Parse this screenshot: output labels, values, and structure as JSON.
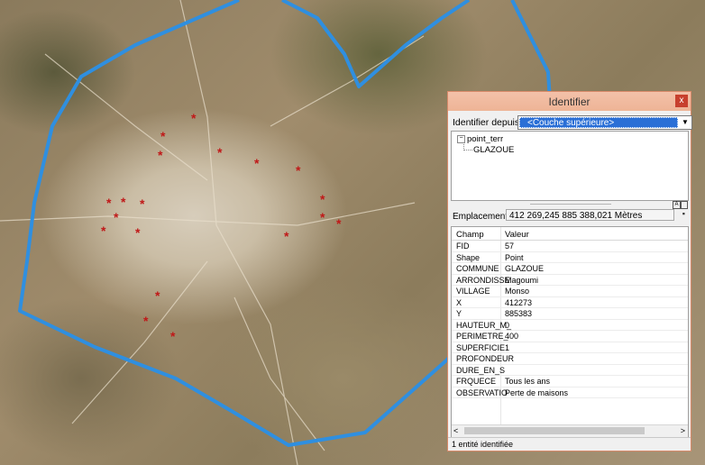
{
  "identify_window": {
    "title": "Identifier",
    "close_glyph": "x",
    "identify_from_label": "Identifier depuis :",
    "identify_from_value": "<Couche supérieure>",
    "tree": {
      "layer": "point_terr",
      "feature": "GLAZOUE"
    },
    "location_label": "Emplacement :",
    "location_value": "412 269,245  885 388,021 Mètres",
    "table": {
      "headers": [
        "Champ",
        "Valeur"
      ],
      "rows": [
        [
          "FID",
          "57"
        ],
        [
          "Shape",
          "Point"
        ],
        [
          "COMMUNE",
          "GLAZOUE"
        ],
        [
          "ARRONDISSE",
          "Magoumi"
        ],
        [
          "VILLAGE",
          "Monso"
        ],
        [
          "X",
          "412273"
        ],
        [
          "Y",
          "885383"
        ],
        [
          "HAUTEUR_M_",
          "0"
        ],
        [
          "PERIMETRE_",
          "400"
        ],
        [
          "SUPERFICIE",
          "1"
        ],
        [
          "PROFONDEUR",
          ""
        ],
        [
          "DURE_EN_S",
          ""
        ],
        [
          "FRQUECE",
          "Tous les ans"
        ],
        [
          "OBSERVATIO",
          "Perte de maisons"
        ]
      ]
    },
    "status": "1 entité identifiée"
  },
  "map": {
    "boundary_color": "#2f8fe0",
    "point_color": "#c01818",
    "point_symbol": "asterisk"
  }
}
